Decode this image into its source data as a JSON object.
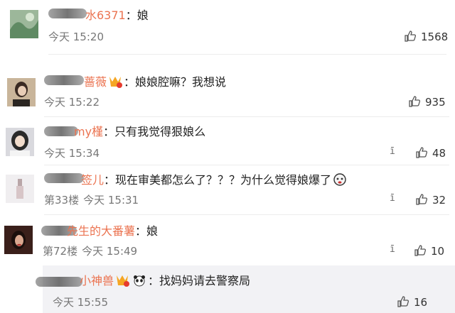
{
  "comments": [
    {
      "nick": "水6371",
      "text": "：娘",
      "time": "今天 15:20",
      "likes": "1568"
    },
    {
      "nick": "蔷薇",
      "text": "：娘娘腔嘛？我想说",
      "time": "今天 15:22",
      "likes": "935"
    },
    {
      "nick": "my槿",
      "text": "：只有我觉得狠娘么",
      "time": "今天 15:34",
      "likes": "48"
    },
    {
      "nick": "签儿",
      "text": "：现在审美都怎么了？？？为什么觉得娘爆了",
      "floor": "第33楼",
      "time": "今天 15:31",
      "likes": "32"
    },
    {
      "nick": "先生的大番薯",
      "text": "：娘",
      "floor": "第72楼",
      "time": "今天 15:49",
      "likes": "10"
    }
  ],
  "reply": {
    "nick": "小神兽",
    "text": "：找妈妈请去警察局",
    "time": "今天 15:55",
    "likes": "16"
  },
  "icons": {
    "like": "thumbs-up-icon",
    "badge": "vip-badge-icon",
    "panda": "panda-emoji-icon",
    "emoji": "face-emoji-icon"
  },
  "colors": {
    "nickname": "#eb7350",
    "text": "#222222",
    "meta": "#777777"
  }
}
